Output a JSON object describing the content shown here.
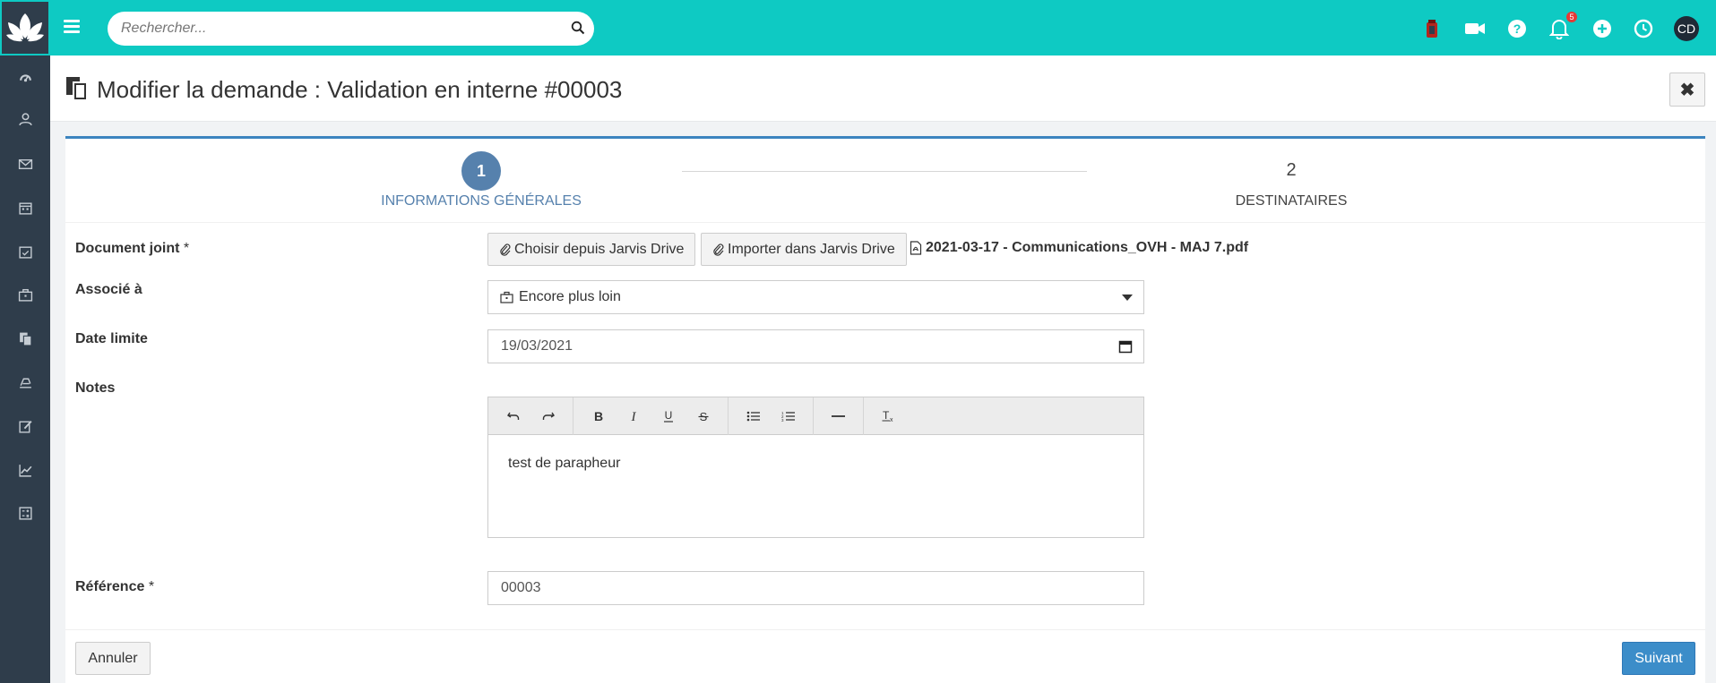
{
  "search": {
    "placeholder": "Rechercher..."
  },
  "topbar": {
    "notification_count": "5",
    "avatar_initials": "CD"
  },
  "sidebar": {
    "items": [
      "dashboard-icon",
      "contacts-icon",
      "mail-icon",
      "calendar-icon",
      "tasks-icon",
      "briefcase-icon",
      "documents-icon",
      "signature-icon",
      "edit-icon",
      "chart-icon",
      "calculator-icon"
    ]
  },
  "page": {
    "title": "Modifier la demande : Validation en interne #00003",
    "close_label": "✖"
  },
  "steps": [
    {
      "number": "1",
      "label": "INFORMATIONS GÉNÉRALES"
    },
    {
      "number": "2",
      "label": "DESTINATAIRES"
    }
  ],
  "form": {
    "document": {
      "label": "Document joint",
      "required_mark": "*",
      "choose_button": "Choisir depuis Jarvis Drive",
      "import_button": "Importer dans Jarvis Drive",
      "file_name": "2021-03-17 - Communications_OVH - MAJ 7.pdf"
    },
    "associated": {
      "label": "Associé à",
      "value": "Encore plus loin"
    },
    "deadline": {
      "label": "Date limite",
      "value": "19/03/2021"
    },
    "notes": {
      "label": "Notes",
      "content": "test de parapheur"
    },
    "reference": {
      "label": "Référence",
      "required_mark": "*",
      "value": "00003"
    }
  },
  "footer": {
    "cancel_label": "Annuler",
    "next_label": "Suivant"
  },
  "colors": {
    "topbar": "#0ecac3",
    "sidebar": "#2f3d4b",
    "accent": "#5681ad",
    "primary_button": "#3c8dc9"
  }
}
